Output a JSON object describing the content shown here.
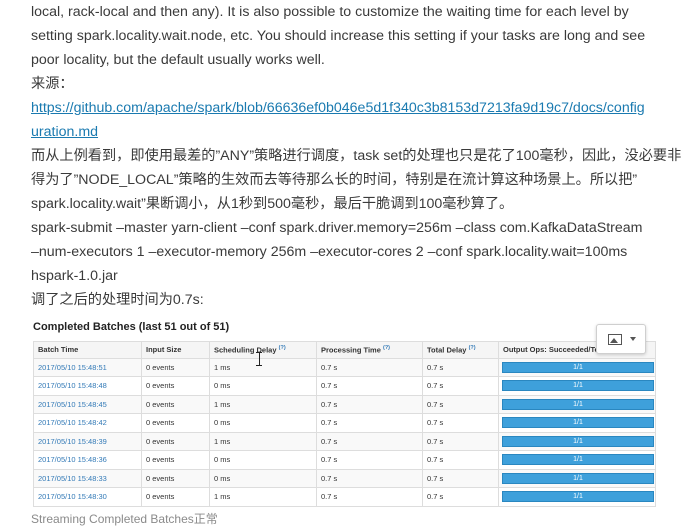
{
  "article": {
    "lines": [
      "local, rack-local and then any). It is also possible to customize the waiting time for each level by",
      "setting spark.locality.wait.node, etc. You should increase this setting if your tasks are long and see",
      "poor locality, but the default usually works well.",
      "来源：",
      "https://github.com/apache/spark/blob/66636ef0b046e5d1f340c3b8153d7213fa9d19c7/docs/config",
      "uration.md",
      "而从上例看到，即使用最差的”ANY”策略进行调度，task set的处理也只是花了100毫秒，因此，没必要非",
      "得为了”NODE_LOCAL”策略的生效而去等待那么长的时间，特别是在流计算这种场景上。所以把”",
      "spark.locality.wait”果断调小，从1秒到500毫秒，最后干脆调到100毫秒算了。",
      "spark-submit –master yarn-client –conf spark.driver.memory=256m –class com.KafkaDataStream",
      "–num-executors 1 –executor-memory 256m –executor-cores 2 –conf spark.locality.wait=100ms",
      "hspark-1.0.jar",
      "调了之后的处理时间为0.7s:"
    ],
    "caption": "Streaming Completed Batches正常"
  },
  "figure": {
    "title": "Completed Batches (last 51 out of 51)",
    "headers": [
      "Batch Time",
      "Input Size",
      "Scheduling Delay",
      "Processing Time",
      "Total Delay",
      "Output Ops: Succeeded/Total"
    ],
    "help_mark": "(?)",
    "rows": [
      [
        "2017/05/10 15:48:51",
        "0 events",
        "1 ms",
        "0.7 s",
        "0.7 s",
        "1/1"
      ],
      [
        "2017/05/10 15:48:48",
        "0 events",
        "0 ms",
        "0.7 s",
        "0.7 s",
        "1/1"
      ],
      [
        "2017/05/10 15:48:45",
        "0 events",
        "1 ms",
        "0.7 s",
        "0.7 s",
        "1/1"
      ],
      [
        "2017/05/10 15:48:42",
        "0 events",
        "0 ms",
        "0.7 s",
        "0.7 s",
        "1/1"
      ],
      [
        "2017/05/10 15:48:39",
        "0 events",
        "1 ms",
        "0.7 s",
        "0.7 s",
        "1/1"
      ],
      [
        "2017/05/10 15:48:36",
        "0 events",
        "0 ms",
        "0.7 s",
        "0.7 s",
        "1/1"
      ],
      [
        "2017/05/10 15:48:33",
        "0 events",
        "0 ms",
        "0.7 s",
        "0.7 s",
        "1/1"
      ],
      [
        "2017/05/10 15:48:30",
        "0 events",
        "1 ms",
        "0.7 s",
        "0.7 s",
        "1/1"
      ]
    ],
    "output_ops_fraction": 1.0
  },
  "colors": {
    "link": "#1a7ab0",
    "bar": "#3ea0db",
    "batch_link": "#337ab7"
  },
  "icons": {
    "image_button": "image-icon",
    "cursor": "text-cursor-icon"
  }
}
